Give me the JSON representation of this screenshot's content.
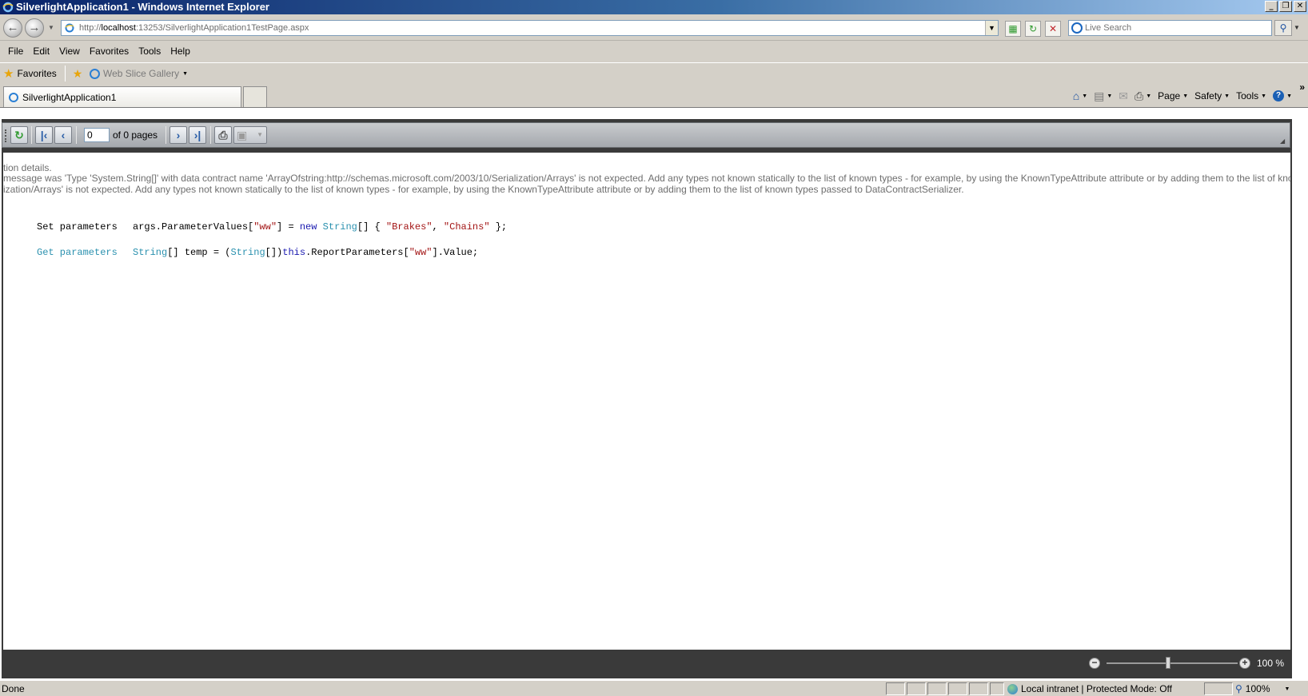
{
  "window": {
    "title": "SilverlightApplication1 - Windows Internet Explorer",
    "controls": {
      "minimize": "_",
      "restore": "❐",
      "close": "✕"
    }
  },
  "address": {
    "url_prefix": "http://",
    "url_host": "localhost",
    "url_rest": ":13253/SilverlightApplication1TestPage.aspx"
  },
  "search": {
    "placeholder": "Live Search"
  },
  "menu": {
    "items": [
      {
        "label": "File"
      },
      {
        "label": "Edit"
      },
      {
        "label": "View"
      },
      {
        "label": "Favorites"
      },
      {
        "label": "Tools"
      },
      {
        "label": "Help"
      }
    ]
  },
  "favorites": {
    "label": "Favorites",
    "web_slice_gallery": "Web Slice Gallery"
  },
  "tabs": {
    "active_label": "SilverlightApplication1"
  },
  "commandbar": {
    "page": "Page",
    "safety": "Safety",
    "tools": "Tools",
    "help": "?",
    "overflow": "»"
  },
  "viewer": {
    "page_number": "0",
    "of_pages": "of 0 pages",
    "error_lines": [
      "tion details.",
      "message was 'Type 'System.String[]' with data contract name 'ArrayOfstring:http://schemas.microsoft.com/2003/10/Serialization/Arrays' is not expected. Add any types not known statically to the list of known types - for example, by using the KnownTypeAttribute attribute or by adding them to the list of known types passed to DataContractSerializer.",
      "ization/Arrays' is not expected. Add any types not known statically to the list of known types - for example, by using the KnownTypeAttribute attribute or by adding them to the list of known types passed to DataContractSerializer."
    ],
    "code": {
      "set_label": "Set parameters",
      "set_1": "args.ParameterValues[",
      "set_2": "\"ww\"",
      "set_3": "] = ",
      "set_4": "new",
      "set_5": " ",
      "set_6": "String",
      "set_7": "[] { ",
      "set_8": "\"Brakes\"",
      "set_9": ", ",
      "set_10": "\"Chains\"",
      "set_11": " };",
      "get_label": "Get parameters",
      "get_1": "String",
      "get_2": "[] temp = (",
      "get_3": "String",
      "get_4": "[])",
      "get_5": "this",
      "get_6": ".ReportParameters[",
      "get_7": "\"ww\"",
      "get_8": "].Value;"
    },
    "zoom_percent": "100 %",
    "zoom_level": 1.0
  },
  "statusbar": {
    "status": "Done",
    "zone": "Local intranet | Protected Mode: Off",
    "zoom": "100%"
  },
  "colors": {
    "keyword": "#1a1ab0",
    "type": "#2b91af",
    "string": "#a31515",
    "error_text": "#6e6e6e",
    "titlebar": "#0a246a"
  }
}
